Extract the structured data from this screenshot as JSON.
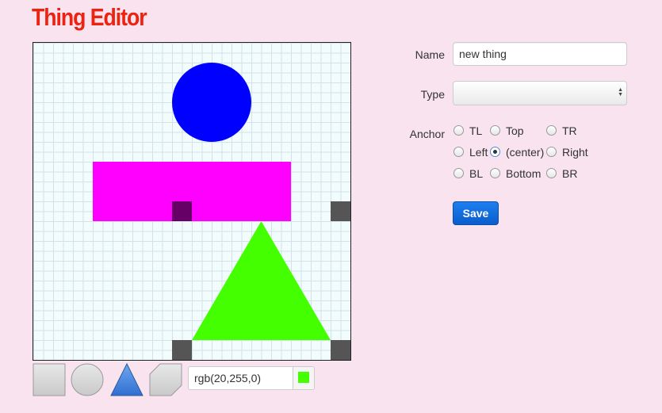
{
  "app": {
    "title": "Thing Editor"
  },
  "canvas": {
    "shapes": [
      {
        "kind": "circle",
        "color": "#0000ff"
      },
      {
        "kind": "rectangle",
        "color": "#ff00ff"
      },
      {
        "kind": "triangle",
        "color": "#44ff00"
      }
    ],
    "handle_color": "#555555",
    "anchor_marker_color": "#660066"
  },
  "toolbar": {
    "tools": [
      "square-tool",
      "circle-tool",
      "triangle-tool",
      "parallelogram-tool"
    ],
    "color_value": "rgb(20,255,0)",
    "swatch_color": "#44ff00"
  },
  "form": {
    "name_label": "Name",
    "name_value": "new thing",
    "type_label": "Type",
    "type_value": "",
    "anchor_label": "Anchor",
    "anchor_options": [
      [
        "TL",
        "Top",
        "TR"
      ],
      [
        "Left",
        "(center)",
        "Right"
      ],
      [
        "BL",
        "Bottom",
        "BR"
      ]
    ],
    "anchor_selected": "(center)",
    "save_label": "Save"
  }
}
